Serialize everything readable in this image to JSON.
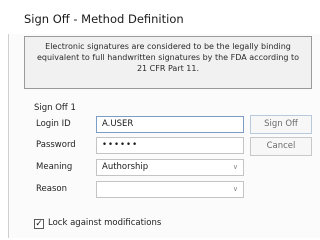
{
  "dialog": {
    "title": "Sign Off - Method Definition",
    "notice": "Electronic signatures are considered to be the legally binding equivalent to full handwritten signatures by the FDA according to 21 CFR Part 11.",
    "section_label": "Sign Off 1"
  },
  "form": {
    "login_id_label": "Login ID",
    "login_id_value": "A.USER",
    "password_label": "Password",
    "password_value": "••••••",
    "meaning_label": "Meaning",
    "meaning_value": "Authorship",
    "reason_label": "Reason",
    "reason_value": ""
  },
  "buttons": {
    "sign_off": "Sign Off",
    "cancel": "Cancel"
  },
  "lock": {
    "label": "Lock against modifications",
    "checked": true,
    "check_glyph": "✓"
  },
  "icons": {
    "dropdown": "chevron-down-icon"
  }
}
